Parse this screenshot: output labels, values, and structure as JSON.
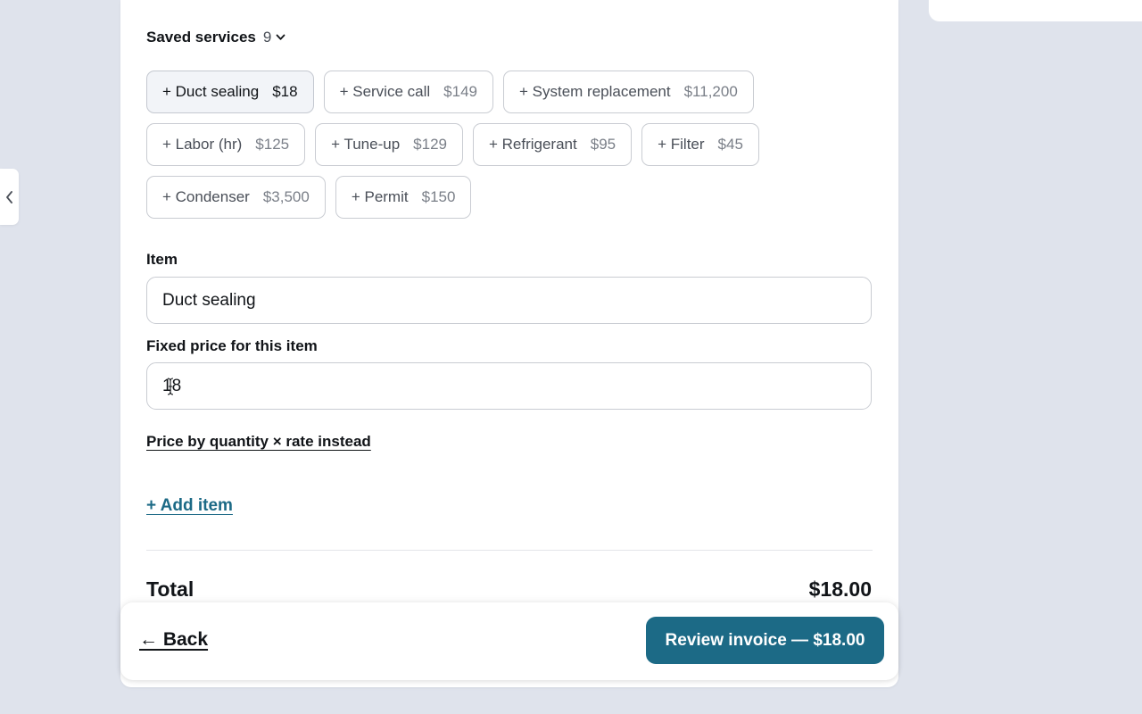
{
  "saved_services": {
    "label": "Saved services",
    "count": "9",
    "chips": [
      {
        "name": "+ Duct sealing",
        "price": "$18",
        "active": true
      },
      {
        "name": "+ Service call",
        "price": "$149"
      },
      {
        "name": "+ System replacement",
        "price": "$11,200"
      },
      {
        "name": "+ Labor (hr)",
        "price": "$125"
      },
      {
        "name": "+ Tune-up",
        "price": "$129"
      },
      {
        "name": "+ Refrigerant",
        "price": "$95"
      },
      {
        "name": "+ Filter",
        "price": "$45"
      },
      {
        "name": "+ Condenser",
        "price": "$3,500"
      },
      {
        "name": "+ Permit",
        "price": "$150"
      }
    ]
  },
  "item": {
    "label": "Item",
    "value": "Duct sealing"
  },
  "fixed_price": {
    "label": "Fixed price for this item",
    "value": "18"
  },
  "links": {
    "quantity_rate": "Price by quantity × rate instead",
    "add_item": "+ Add item"
  },
  "total": {
    "label": "Total",
    "value": "$18.00"
  },
  "footer": {
    "back": "← Back",
    "review": "Review invoice — $18.00"
  },
  "colors": {
    "accent": "#1c6a86",
    "background": "#dfe3ec"
  },
  "icons": {
    "side_toggle": "chevron-left-icon",
    "saved_toggle": "chevron-down-icon",
    "text_cursor": "text-cursor-icon"
  }
}
